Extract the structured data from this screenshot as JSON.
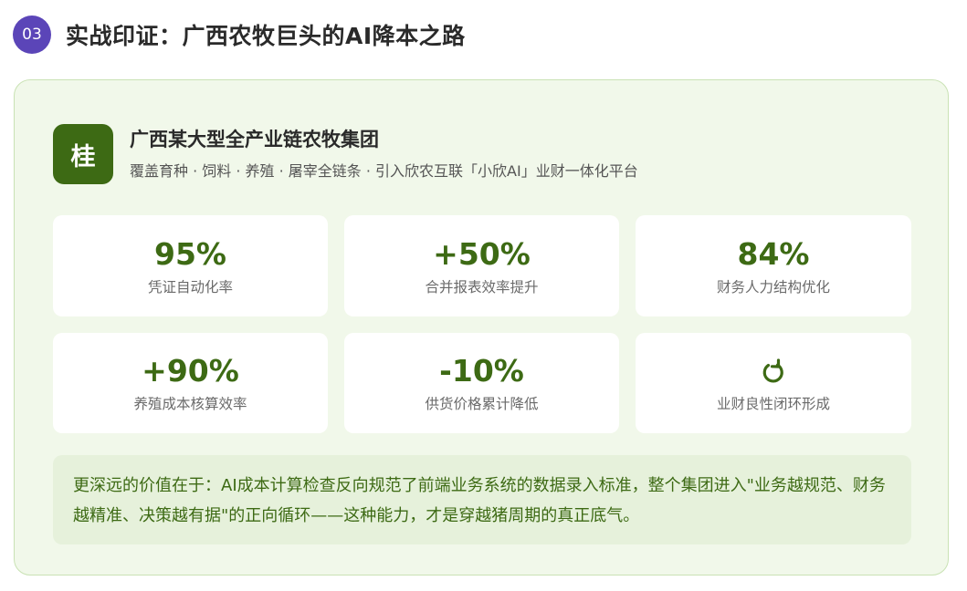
{
  "header": {
    "section_number": "03",
    "title": "实战印证：广西农牧巨头的AI降本之路"
  },
  "org": {
    "logo_char": "桂",
    "name": "广西某大型全产业链农牧集团",
    "description": "覆盖育种 · 饲料 · 养殖 · 屠宰全链条 · 引入欣农互联「小欣AI」业财一体化平台"
  },
  "metrics": [
    {
      "value": "95%",
      "label": "凭证自动化率"
    },
    {
      "value": "+50%",
      "label": "合并报表效率提升"
    },
    {
      "value": "84%",
      "label": "财务人力结构优化"
    },
    {
      "value": "+90%",
      "label": "养殖成本核算效率"
    },
    {
      "value": "-10%",
      "label": "供货价格累计降低"
    },
    {
      "icon": "refresh-cycle-icon",
      "label": "业财良性闭环形成"
    }
  ],
  "insight": {
    "text": "更深远的价值在于：AI成本计算检查反向规范了前端业务系统的数据录入标准，整个集团进入\"业务越规范、财务越精准、决策越有据\"的正向循环——这种能力，才是穿越猪周期的真正底气。"
  },
  "colors": {
    "badge": "#5b45b8",
    "accent_green": "#3d6a14",
    "card_bg": "#f1f8ea",
    "card_border": "#c9e2b4",
    "insight_bg": "#e6f1db"
  }
}
